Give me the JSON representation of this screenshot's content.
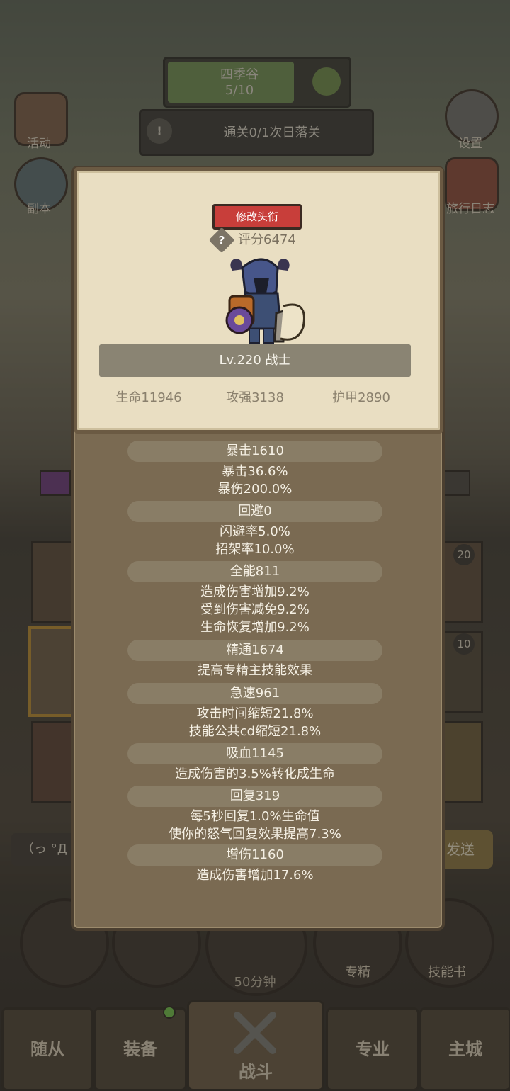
{
  "background": {
    "stage_name": "四季谷",
    "stage_progress": "5/10",
    "clear_task": "通关0/1次日落关",
    "left_icons": [
      "活动",
      "副本"
    ],
    "right_icons": [
      "设置",
      "旅行日志"
    ],
    "chat_prefix": "（っ °Д",
    "send_button": "发送",
    "timer": "50分钟",
    "bottom_buttons": [
      "专精",
      "技能书"
    ],
    "badge_counts": [
      "20",
      "10"
    ],
    "tabs": [
      "随从",
      "装备",
      "战斗",
      "专业",
      "主城"
    ]
  },
  "card": {
    "change_title_button": "修改头衔",
    "help_icon": "?",
    "score": "评分6474",
    "level_class": "Lv.220 战士",
    "base_stats": [
      "生命11946",
      "攻强3138",
      "护甲2890"
    ]
  },
  "stats": {
    "crit_head": "暴击1610",
    "crit_lines": [
      "暴击36.6%",
      "暴伤200.0%"
    ],
    "dodge_head": "回避0",
    "dodge_lines": [
      "闪避率5.0%",
      "招架率10.0%"
    ],
    "versatility_head": "全能811",
    "versatility_lines": [
      "造成伤害增加9.2%",
      "受到伤害减免9.2%",
      "生命恢复增加9.2%"
    ],
    "mastery_head": "精通1674",
    "mastery_lines": [
      "提高专精主技能效果"
    ],
    "haste_head": "急速961",
    "haste_lines": [
      "攻击时间缩短21.8%",
      "技能公共cd缩短21.8%"
    ],
    "leech_head": "吸血1145",
    "leech_lines": [
      "造成伤害的3.5%转化成生命"
    ],
    "regen_head": "回复319",
    "regen_lines": [
      "每5秒回复1.0%生命值",
      "使你的怒气回复效果提高7.3%"
    ],
    "damage_head": "增伤1160",
    "damage_lines": [
      "造成伤害增加17.6%"
    ]
  },
  "colors": {
    "title_button": "#c83e3a",
    "card_paper": "#e9dec2",
    "dialog_bg": "#7a6a52"
  }
}
